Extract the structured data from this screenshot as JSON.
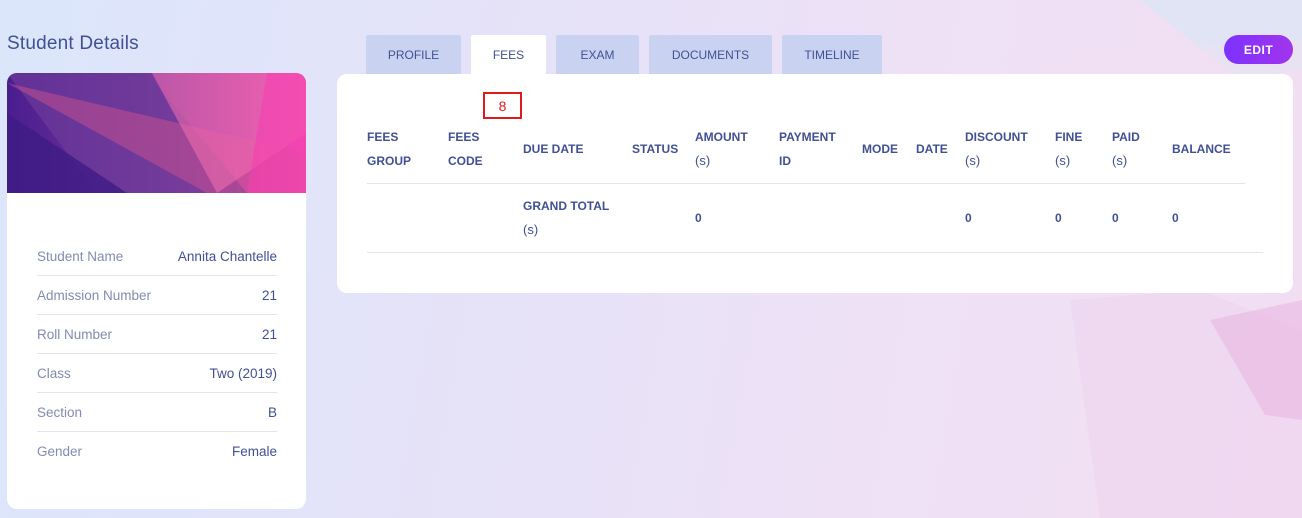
{
  "page_title": "Student Details",
  "student": {
    "fields": [
      {
        "label": "Student Name",
        "value": "Annita Chantelle"
      },
      {
        "label": "Admission Number",
        "value": "21"
      },
      {
        "label": "Roll Number",
        "value": "21"
      },
      {
        "label": "Class",
        "value": "Two (2019)"
      },
      {
        "label": "Section",
        "value": "B"
      },
      {
        "label": "Gender",
        "value": "Female"
      }
    ]
  },
  "tabs": [
    {
      "label": "PROFILE",
      "active": false
    },
    {
      "label": "FEES",
      "active": true
    },
    {
      "label": "EXAM",
      "active": false
    },
    {
      "label": "DOCUMENTS",
      "active": false
    },
    {
      "label": "TIMELINE",
      "active": false
    }
  ],
  "edit_button": "EDIT",
  "marker": "8",
  "fees_table": {
    "headers": [
      {
        "line1": "FEES",
        "line2": "GROUP"
      },
      {
        "line1": "FEES",
        "line2": "CODE"
      },
      {
        "line1": "DUE DATE",
        "line2": ""
      },
      {
        "line1": "STATUS",
        "line2": ""
      },
      {
        "line1": "AMOUNT",
        "line2": "(s)"
      },
      {
        "line1": "PAYMENT",
        "line2": "ID"
      },
      {
        "line1": "MODE",
        "line2": ""
      },
      {
        "line1": "DATE",
        "line2": ""
      },
      {
        "line1": "DISCOUNT",
        "line2": "(s)"
      },
      {
        "line1": "FINE",
        "line2": "(s)"
      },
      {
        "line1": "PAID",
        "line2": "(s)"
      },
      {
        "line1": "BALANCE",
        "line2": ""
      }
    ],
    "grand_total": {
      "label_line1": "GRAND TOTAL",
      "label_line2": "(s)",
      "amount": "0",
      "discount": "0",
      "fine": "0",
      "paid": "0",
      "balance": "0"
    }
  }
}
